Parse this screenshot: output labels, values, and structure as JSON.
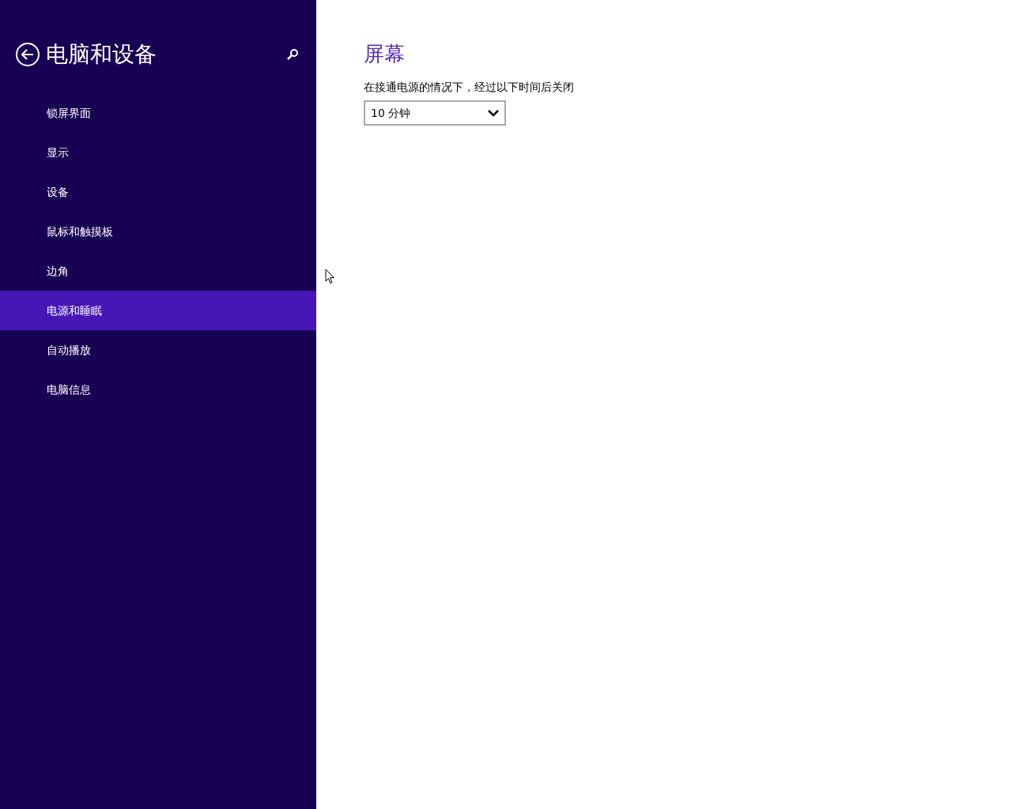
{
  "sidebar": {
    "title": "电脑和设备",
    "items": [
      {
        "label": "锁屏界面",
        "selected": false
      },
      {
        "label": "显示",
        "selected": false
      },
      {
        "label": "设备",
        "selected": false
      },
      {
        "label": "鼠标和触摸板",
        "selected": false
      },
      {
        "label": "边角",
        "selected": false
      },
      {
        "label": "电源和睡眠",
        "selected": true
      },
      {
        "label": "自动播放",
        "selected": false
      },
      {
        "label": "电脑信息",
        "selected": false
      }
    ]
  },
  "content": {
    "heading": "屏幕",
    "setting_label": "在接通电源的情况下，经过以下时间后关闭",
    "dropdown": {
      "value": "10 分钟"
    }
  }
}
